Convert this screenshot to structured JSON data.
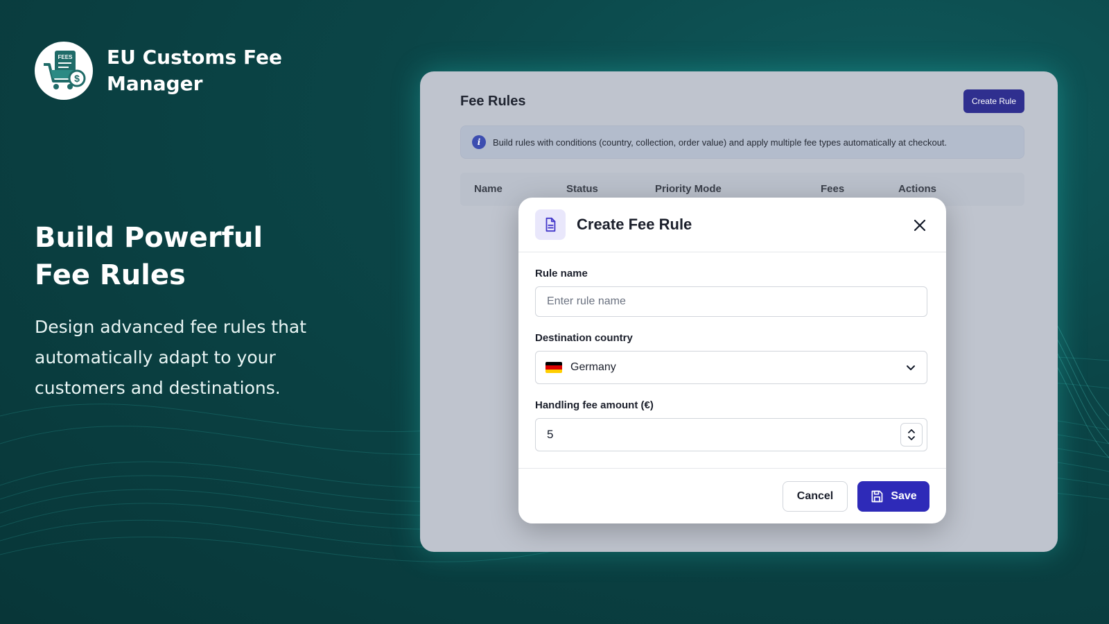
{
  "brand": {
    "logo_text": "FEES",
    "name": "EU Customs Fee Manager"
  },
  "hero": {
    "headline_line1": "Build Powerful",
    "headline_line2": "Fee Rules",
    "subtext": "Design advanced fee rules that automatically adapt to your customers and destinations."
  },
  "panel": {
    "title": "Fee Rules",
    "create_rule_label": "Create Rule",
    "info_text": "Build rules with conditions (country, collection, order value) and apply multiple fee types automatically at checkout.",
    "columns": [
      "Name",
      "Status",
      "Priority Mode",
      "Fees",
      "Actions"
    ]
  },
  "modal": {
    "title": "Create Fee Rule",
    "rule_name_label": "Rule name",
    "rule_name_placeholder": "Enter rule name",
    "country_label": "Destination country",
    "country_value": "Germany",
    "fee_label": "Handling fee amount (€)",
    "fee_value": "5",
    "cancel_label": "Cancel",
    "save_label": "Save"
  },
  "colors": {
    "background": "#0b4547",
    "accent": "#2e2ab8",
    "panel": "#bfc4ce"
  }
}
